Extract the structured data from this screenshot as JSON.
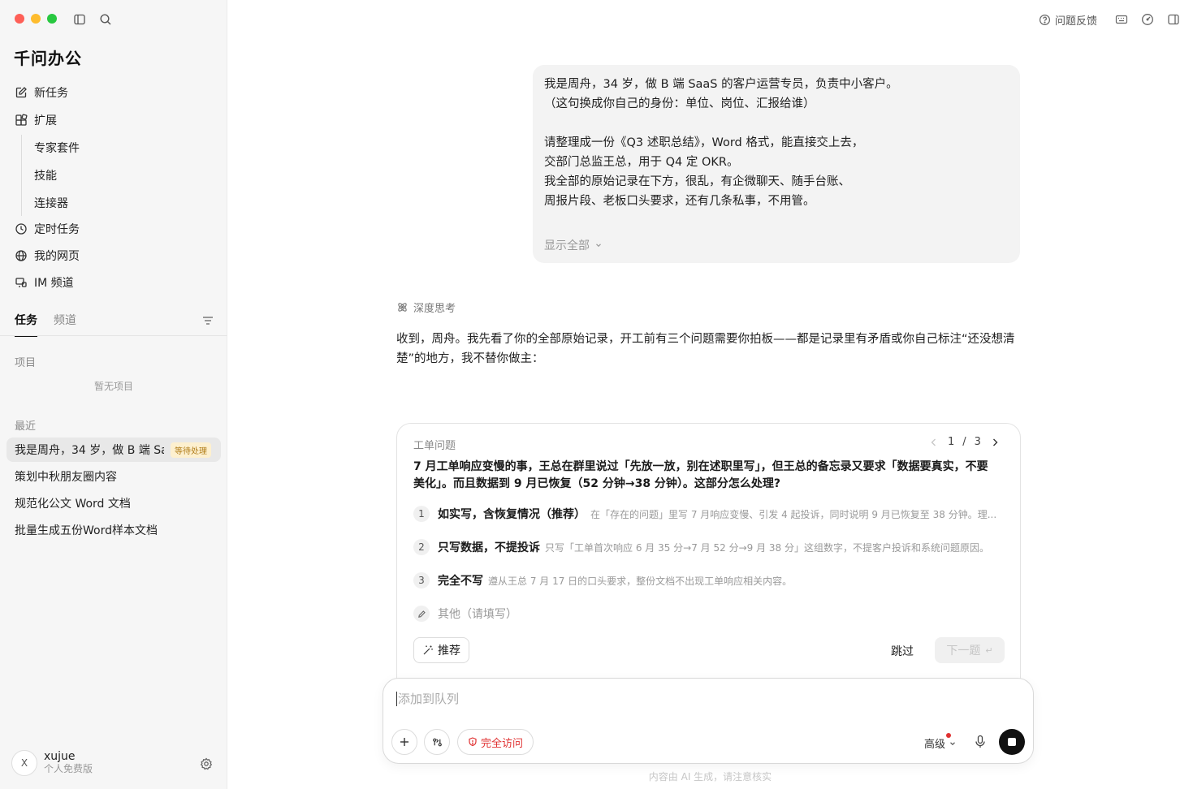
{
  "app": {
    "brand": "千问办公"
  },
  "sidebar": {
    "nav": [
      {
        "label": "新任务",
        "icon": "edit-icon"
      },
      {
        "label": "扩展",
        "icon": "extension-icon"
      }
    ],
    "sub_items": [
      "专家套件",
      "技能",
      "连接器"
    ],
    "nav2": [
      {
        "label": "定时任务",
        "icon": "clock-icon"
      },
      {
        "label": "我的网页",
        "icon": "globe-icon"
      },
      {
        "label": "IM 频道",
        "icon": "im-channel-icon"
      }
    ],
    "tabs": [
      "任务",
      "频道"
    ],
    "projects_label": "项目",
    "projects_empty": "暂无项目",
    "recent_label": "最近",
    "recent": [
      {
        "title": "我是周舟，34 岁，做 B 端 SaaS 的客户运营专员",
        "badge": "等待处理"
      },
      {
        "title": "策划中秋朋友圈内容"
      },
      {
        "title": "规范化公文 Word 文档"
      },
      {
        "title": "批量生成五份Word样本文档"
      }
    ],
    "user": {
      "initial": "X",
      "name": "xujue",
      "plan": "个人免费版"
    }
  },
  "header": {
    "feedback": "问题反馈"
  },
  "chat": {
    "user_message_lines": [
      "我是周舟，34 岁，做 B 端 SaaS 的客户运营专员，负责中小客户。",
      "（这句换成你自己的身份：单位、岗位、汇报给谁）",
      "",
      "请整理成一份《Q3 述职总结》，Word 格式，能直接交上去，",
      "交部门总监王总，用于 Q4 定 OKR。",
      "我全部的原始记录在下方，很乱，有企微聊天、随手台账、",
      "周报片段、老板口头要求，还有几条私事，不用管。"
    ],
    "show_all": "显示全部",
    "deep_think": "深度思考",
    "reply": "收到，周舟。我先看了你的全部原始记录，开工前有三个问题需要你拍板——都是记录里有矛盾或你自己标注“还没想清楚”的地方，我不替你做主："
  },
  "question": {
    "category": "工单问题",
    "pager": {
      "current": "1",
      "sep": "/",
      "total": "3"
    },
    "text": "7 月工单响应变慢的事，王总在群里说过「先放一放，别在述职里写」，但王总的备忘录又要求「数据要真实，不要美化」。而且数据到 9 月已恢复（52 分钟→38 分钟）。这部分怎么处理?",
    "options": [
      {
        "num": "1",
        "title": "如实写，含恢复情况（推荐）",
        "desc": "在「存在的问题」里写 7 月响应变慢、引发 4 起投诉，同时说明 9 月已恢复至 38 分钟。理..."
      },
      {
        "num": "2",
        "title": "只写数据，不提投诉",
        "desc": "只写「工单首次响应 6 月 35 分→7 月 52 分→9 月 38 分」这组数字，不提客户投诉和系统问题原因。"
      },
      {
        "num": "3",
        "title": "完全不写",
        "desc": "遵从王总 7 月 17 日的口头要求，整份文档不出现工单响应相关内容。"
      }
    ],
    "other": "其他（请填写）",
    "recommend": "推荐",
    "skip": "跳过",
    "next": "下一题",
    "next_key": "↵"
  },
  "composer": {
    "placeholder": "添加到队列",
    "access": "完全访问",
    "level": "高级",
    "footnote": "内容由 AI 生成，请注意核实"
  }
}
